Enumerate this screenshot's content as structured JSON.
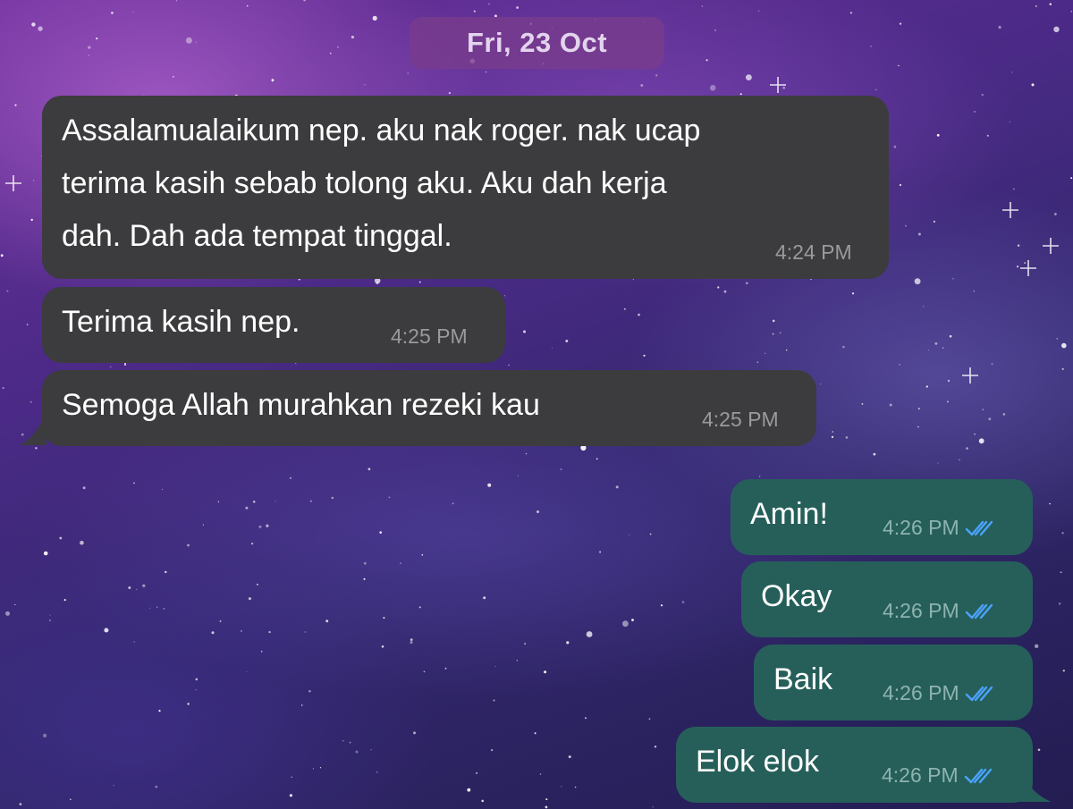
{
  "chat": {
    "date": "Fri, 23 Oct",
    "messages": [
      {
        "direction": "incoming",
        "text": "Assalamualaikum nep. aku nak roger. nak ucap\nterima kasih sebab tolong aku. Aku dah kerja\ndah. Dah ada tempat tinggal.",
        "time": "4:24 PM"
      },
      {
        "direction": "incoming",
        "text": "Terima kasih nep.",
        "time": "4:25 PM"
      },
      {
        "direction": "incoming",
        "text": "Semoga Allah murahkan rezeki kau",
        "time": "4:25 PM"
      },
      {
        "direction": "outgoing",
        "text": "Amin!",
        "time": "4:26 PM",
        "status": "read"
      },
      {
        "direction": "outgoing",
        "text": "Okay",
        "time": "4:26 PM",
        "status": "read"
      },
      {
        "direction": "outgoing",
        "text": "Baik",
        "time": "4:26 PM",
        "status": "read"
      },
      {
        "direction": "outgoing",
        "text": "Elok elok",
        "time": "4:26 PM",
        "status": "read"
      }
    ]
  },
  "icons": {
    "read_receipt": "double-check-icon"
  },
  "colors": {
    "incoming_bubble": "#3c3c3e",
    "outgoing_bubble": "#265f5a",
    "read_tick": "#4aa3ff",
    "date_pill": "#783c8c"
  }
}
